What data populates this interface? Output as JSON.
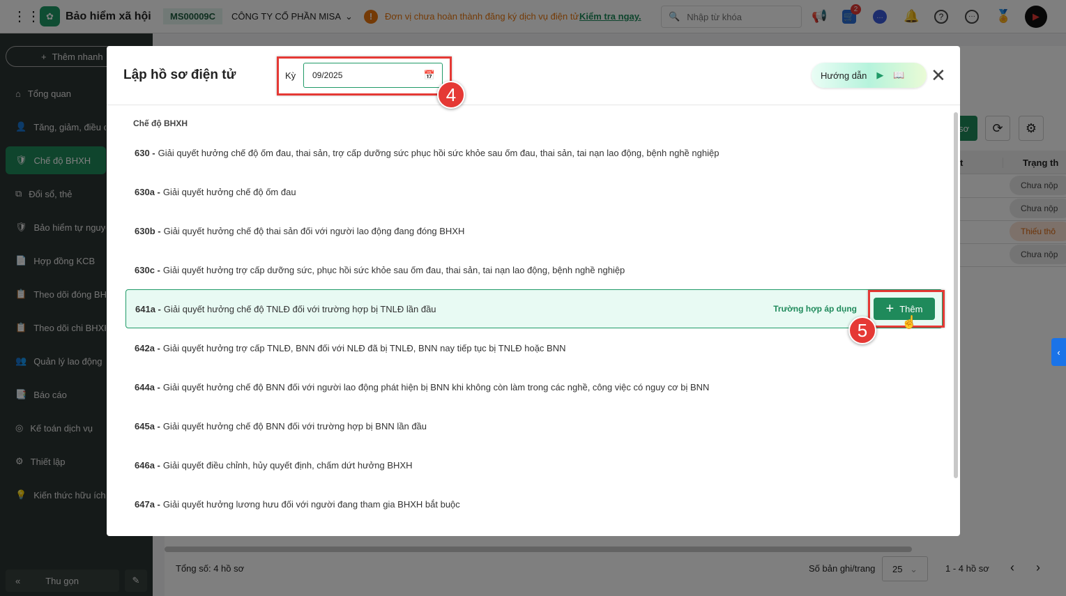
{
  "topbar": {
    "app_title": "Bảo hiểm xã hội",
    "company_code": "MS00009C",
    "company_name": "CÔNG TY CỔ PHẦN MISA",
    "warning": "Đơn vị chưa hoàn thành đăng ký dịch vụ điện tử.",
    "warning_link": "Kiểm tra ngay.",
    "search_placeholder": "Nhập từ khóa",
    "cart_badge": "2"
  },
  "sidebar": {
    "quick_add": "Thêm nhanh",
    "items": [
      {
        "label": "Tổng quan"
      },
      {
        "label": "Tăng, giảm, điều chỉnh"
      },
      {
        "label": "Chế độ BHXH"
      },
      {
        "label": "Đổi sổ, thẻ"
      },
      {
        "label": "Bảo hiểm tự nguyện"
      },
      {
        "label": "Hợp đồng KCB"
      },
      {
        "label": "Theo dõi đóng BHXH"
      },
      {
        "label": "Theo dõi chi BHXH"
      },
      {
        "label": "Quản lý lao động"
      },
      {
        "label": "Báo cáo"
      },
      {
        "label": "Kế toán dịch vụ"
      },
      {
        "label": "Thiết lập"
      },
      {
        "label": "Kiến thức hữu ích"
      }
    ],
    "collapse": "Thu gọn"
  },
  "background": {
    "create_btn": "sơ",
    "col_status": "Trạng th",
    "col_prev": "t",
    "statuses": [
      "Chưa nộp",
      "Chưa nộp",
      "Thiếu thô",
      "Chưa nộp"
    ],
    "total": "Tổng số: 4 hồ sơ",
    "per_page_label": "Số bản ghi/trang",
    "per_page": "25",
    "range": "1 - 4 hồ sơ"
  },
  "modal": {
    "title": "Lập hồ sơ điện tử",
    "period_label": "Kỳ",
    "period_value": "09/2025",
    "guide": "Hướng dẫn",
    "section": "Chế độ BHXH",
    "apply_label": "Trường hợp áp dụng",
    "add_label": "Thêm",
    "items": [
      {
        "code": "630 -",
        "text": "Giải quyết hưởng chế độ ốm đau, thai sản, trợ cấp dưỡng sức phục hồi sức khỏe sau ốm đau, thai sản, tai nạn lao động, bệnh nghề nghiệp"
      },
      {
        "code": "630a -",
        "text": "Giải quyết hưởng chế độ ốm đau"
      },
      {
        "code": "630b -",
        "text": "Giải quyết hưởng chế độ thai sản đối với người lao động đang đóng BHXH"
      },
      {
        "code": "630c -",
        "text": "Giải quyết hưởng trợ cấp dưỡng sức, phục hồi sức khỏe sau ốm đau, thai sản, tai nạn lao động, bệnh nghề nghiệp"
      },
      {
        "code": "641a -",
        "text": "Giải quyết hưởng chế độ TNLĐ đối với trường hợp bị TNLĐ lần đầu"
      },
      {
        "code": "642a -",
        "text": "Giải quyết hưởng trợ cấp TNLĐ, BNN đối với NLĐ đã bị TNLĐ, BNN nay tiếp tục bị TNLĐ hoặc BNN"
      },
      {
        "code": "644a -",
        "text": "Giải quyết hưởng chế độ BNN đối với người lao động phát hiện bị BNN khi không còn làm trong các nghề, công việc có nguy cơ bị BNN"
      },
      {
        "code": "645a -",
        "text": "Giải quyết hưởng chế độ BNN đối với trường hợp bị BNN lần đầu"
      },
      {
        "code": "646a -",
        "text": "Giải quyết điều chỉnh, hủy quyết định, chấm dứt hưởng BHXH"
      },
      {
        "code": "647a -",
        "text": "Giải quyết hưởng lương hưu đối với người đang tham gia BHXH bắt buộc"
      }
    ]
  },
  "annotations": {
    "step4": "4",
    "step5": "5"
  }
}
